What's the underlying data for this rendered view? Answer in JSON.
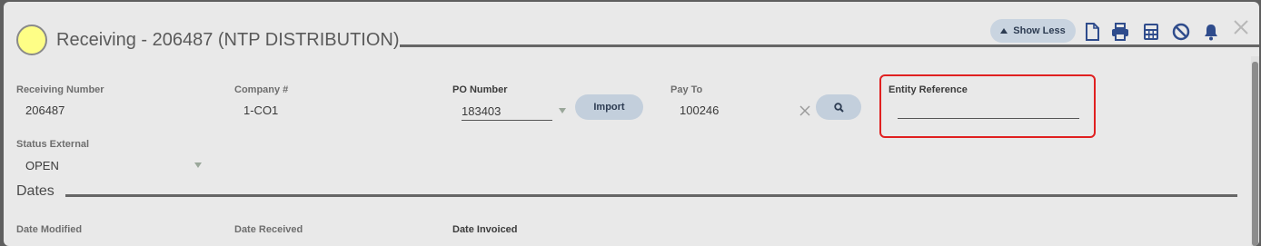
{
  "header": {
    "title": "Receiving - 206487 (NTP DISTRIBUTION)",
    "status_color": "#fefe86",
    "show_less_label": "Show Less"
  },
  "toolbar": {
    "icons": [
      "document-icon",
      "print-icon",
      "calculator-icon",
      "cancel-icon",
      "bell-icon",
      "close-icon"
    ],
    "icon_color": "#2f4c8c"
  },
  "fields": {
    "receiving_number": {
      "label": "Receiving Number",
      "value": "206487"
    },
    "company": {
      "label": "Company #",
      "value": "1-CO1"
    },
    "po_number": {
      "label": "PO Number",
      "value": "183403"
    },
    "import_label": "Import",
    "pay_to": {
      "label": "Pay To",
      "value": "100246"
    },
    "entity_reference": {
      "label": "Entity Reference",
      "value": ""
    },
    "status_external": {
      "label": "Status External",
      "value": "OPEN"
    }
  },
  "dates": {
    "title": "Dates",
    "date_modified_label": "Date Modified",
    "date_received_label": "Date Received",
    "date_invoiced_label": "Date Invoiced"
  },
  "colors": {
    "highlight": "#e02020",
    "pill_button": "#c3cfdc"
  }
}
